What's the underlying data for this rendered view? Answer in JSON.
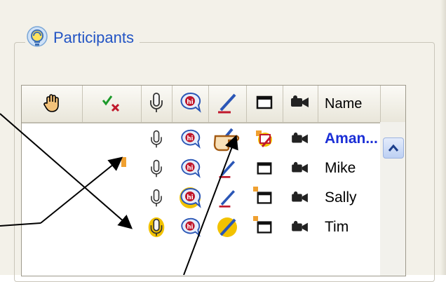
{
  "panel": {
    "title": "Participants",
    "title_icon": "participants-bulb-icon"
  },
  "columns": [
    {
      "key": "raise_hand",
      "icon": "raise-hand-icon"
    },
    {
      "key": "agree_disagree",
      "icon": "check-x-icon"
    },
    {
      "key": "microphone",
      "icon": "microphone-icon"
    },
    {
      "key": "chat",
      "icon": "chat-hi-icon"
    },
    {
      "key": "annotate",
      "icon": "pencil-icon"
    },
    {
      "key": "share",
      "icon": "screen-icon"
    },
    {
      "key": "video",
      "icon": "video-camera-icon"
    },
    {
      "key": "name",
      "label": "Name"
    }
  ],
  "participants": [
    {
      "name": "Aman...",
      "presenter": true
    },
    {
      "name": "Mike",
      "presenter": false
    },
    {
      "name": "Sally",
      "presenter": false
    },
    {
      "name": "Tim",
      "presenter": false
    }
  ],
  "colors": {
    "accent_blue": "#2254c4",
    "presenter_name": "#1a2ed6",
    "highlight_yellow": "#f2c200",
    "marker_orange": "#f0a030",
    "chat_red": "#c0182c"
  }
}
